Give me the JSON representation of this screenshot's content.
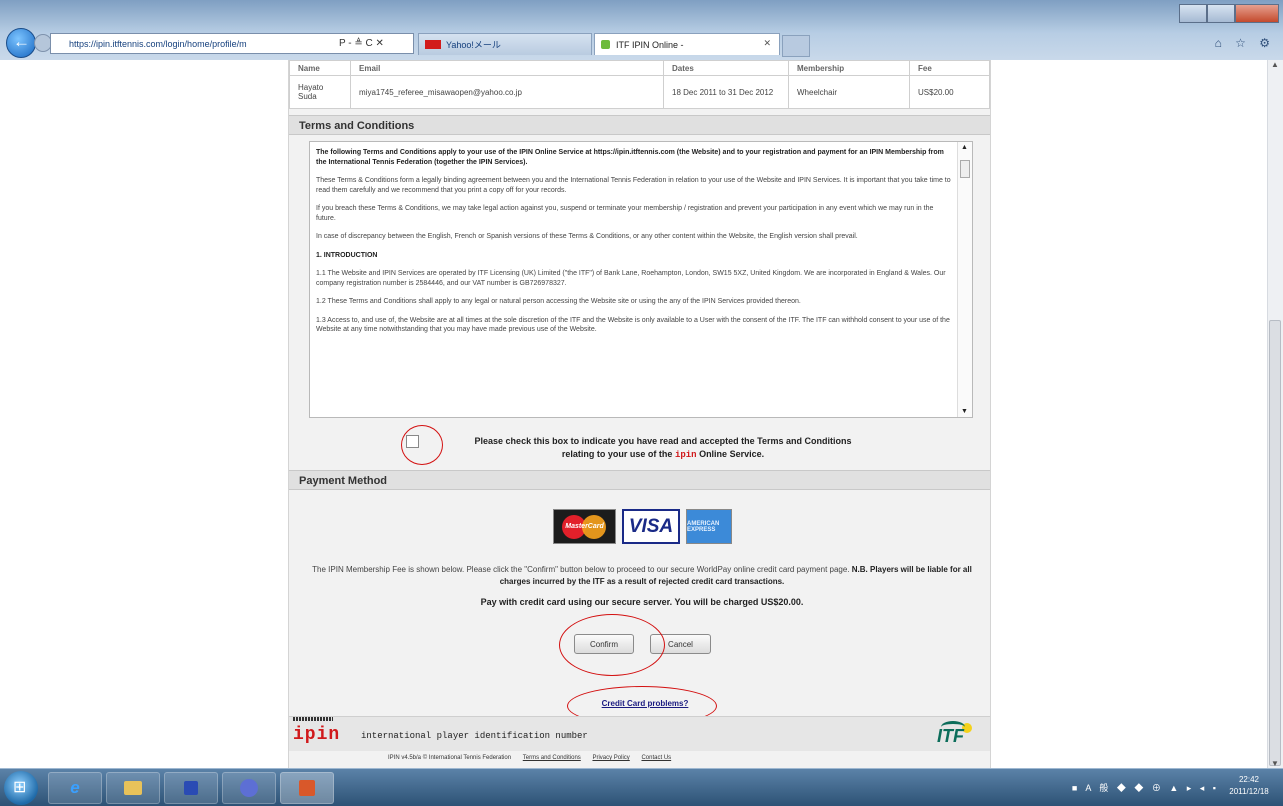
{
  "browser": {
    "address_url": "https://ipin.itftennis.com/login/home/profile/m",
    "address_controls": "P - ≜ C ✕",
    "tabs": [
      {
        "label": "Yahoo!メール",
        "active": false
      },
      {
        "label": "ITF IPIN Online -",
        "active": true
      }
    ],
    "tools_glyphs": "⌂ ☆ ⚙"
  },
  "membership_table": {
    "header": [
      "Name",
      "Email",
      "Dates",
      "Membership",
      "Fee"
    ],
    "rows": [
      {
        "name": "Hayato Suda",
        "email": "miya1745_referee_misawaopen@yahoo.co.jp",
        "dates": "18 Dec 2011 to 31 Dec 2012",
        "membership": "Wheelchair",
        "fee": "US$20.00"
      }
    ]
  },
  "terms": {
    "heading": "Terms and Conditions",
    "intro": "The following Terms and Conditions apply to your use of the IPIN Online Service at https://ipin.itftennis.com (the Website) and to your registration and payment for an IPIN Membership from the International Tennis Federation (together the IPIN Services).",
    "para1": "These Terms & Conditions form a legally binding agreement between you and the International Tennis Federation in relation to your use of the Website and IPIN Services. It is important that you take time to read them carefully and we recommend that you print a copy off for your records.",
    "para2": "If you breach these Terms & Conditions, we may take legal action against you, suspend or terminate your membership / registration and prevent your participation in any event which we may run in the future.",
    "para3": "In case of discrepancy between the English, French or Spanish versions of these Terms & Conditions, or any other content within the Website, the English version shall prevail.",
    "section_title": "1. INTRODUCTION",
    "p11": "1.1 The Website and IPIN Services are operated by ITF Licensing (UK) Limited (\"the ITF\") of Bank Lane, Roehampton, London, SW15 5XZ, United Kingdom. We are incorporated in England & Wales. Our company registration number is 2584446, and our VAT number is GB726978327.",
    "p12": "1.2 These Terms and Conditions shall apply to any legal or natural person accessing the Website site or using the any of the IPIN Services provided thereon.",
    "p13": "1.3 Access to, and use of, the Website are at all times at the sole discretion of the ITF and the Website is only available to a User with the consent of the ITF. The ITF can withhold consent to your use of the Website at any time notwithstanding that you may have made previous use of the Website.",
    "agree_line1": "Please check this box to indicate you have read and accepted the Terms and Conditions",
    "agree_line2_pre": "relating to your use of the",
    "agree_ipin": "ipin",
    "agree_line2_post": "Online Service."
  },
  "payment": {
    "heading": "Payment Method",
    "cards": {
      "mastercard": "MasterCard",
      "visa": "VISA",
      "amex": "AMERICAN EXPRESS"
    },
    "fee_info": "The IPIN Membership Fee is shown below. Please click the \"Confirm\" button below to proceed to our secure WorldPay online credit card payment page.",
    "fee_info_bold": "N.B. Players will be liable for all charges incurred by the ITF as a result of rejected credit card transactions.",
    "charge_text": "Pay with credit card using our secure server. You will be charged US$20.00.",
    "confirm_label": "Confirm",
    "cancel_label": "Cancel",
    "cc_problems_link": "Credit Card problems?"
  },
  "footer": {
    "logo": "ipin",
    "tagline": "international player identification number",
    "itf_logo": "ITF",
    "version": "IPIN v4.5b/a",
    "copyright": "© International Tennis Federation",
    "links": [
      "Terms and Conditions",
      "Privacy Policy",
      "Contact Us"
    ]
  },
  "taskbar": {
    "tray_glyphs": "■ A 般 ◆ ◆ ⊕ ▲ ▸ ◂ ▪",
    "time": "22:42",
    "date": "2011/12/18"
  },
  "colors": {
    "ipin_red": "#d0191b",
    "itf_green": "#0b6d5a",
    "annotation_red": "#d31010"
  }
}
